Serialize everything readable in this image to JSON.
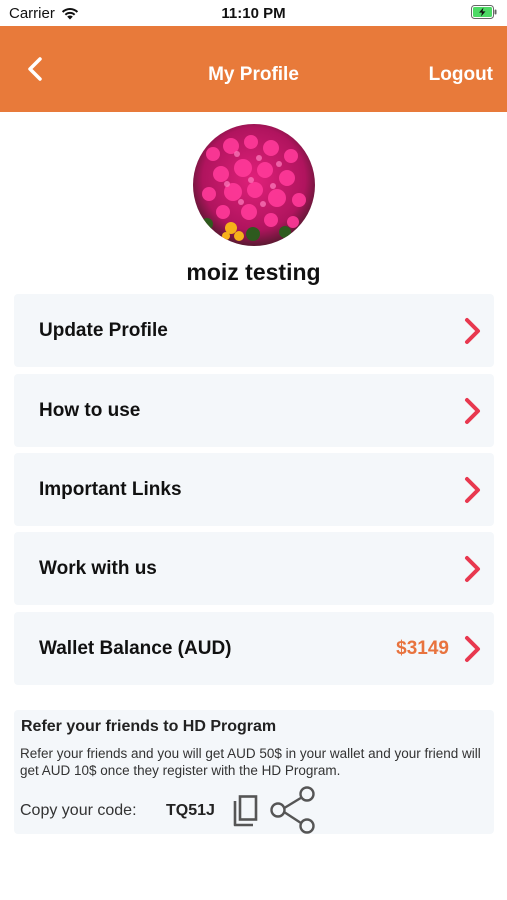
{
  "status_bar": {
    "carrier": "Carrier",
    "time": "11:10 PM",
    "wifi_icon": "wifi-icon",
    "battery_icon": "battery-charging-icon"
  },
  "header": {
    "title": "My Profile",
    "back_icon": "chevron-left-icon",
    "logout_label": "Logout",
    "color": "#E87A3A"
  },
  "profile": {
    "avatar": "avatar-image",
    "name": "moiz testing"
  },
  "menu": {
    "items": [
      {
        "label": "Update Profile",
        "icon": "chevron-right-icon"
      },
      {
        "label": "How to use",
        "icon": "chevron-right-icon"
      },
      {
        "label": "Important Links",
        "icon": "chevron-right-icon"
      },
      {
        "label": "Work with us",
        "icon": "chevron-right-icon"
      },
      {
        "label": "Wallet Balance (AUD)",
        "value": "$3149",
        "icon": "chevron-right-icon"
      }
    ],
    "chevron_color": "#E8384F",
    "value_color": "#E8733E"
  },
  "refer": {
    "title": "Refer your friends to HD Program",
    "description": "Refer your friends and you will get AUD 50$ in your wallet and your friend will get AUD 10$ once they register with the HD Program.",
    "code_label": "Copy your code:",
    "code": "TQ51J",
    "copy_icon": "copy-icon",
    "share_icon": "share-icon"
  }
}
